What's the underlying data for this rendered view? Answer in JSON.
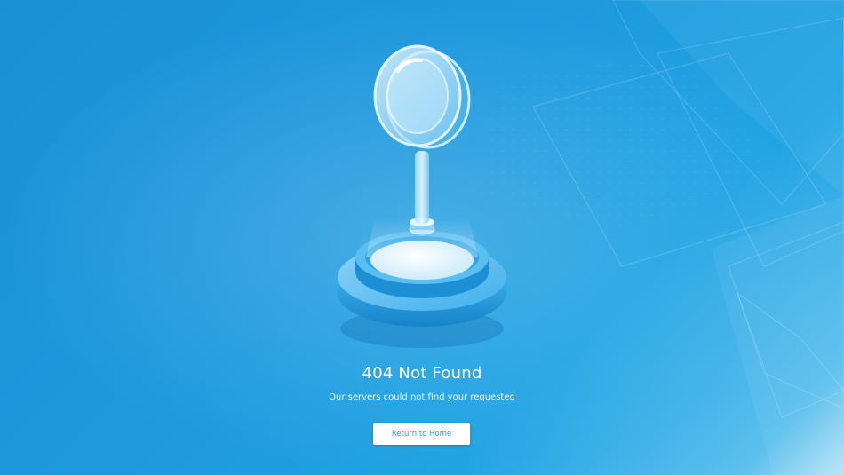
{
  "error": {
    "title": "404 Not Found",
    "subtitle": "Our servers could not find your requested"
  },
  "actions": {
    "return_home_label": "Return to Home"
  },
  "illustration": {
    "icon": "magnifying-glass-on-pedestal-icon"
  },
  "colors": {
    "background": "#1d9ade",
    "text": "#ffffff",
    "button_background": "#ffffff",
    "button_text": "#2d9fe0"
  }
}
